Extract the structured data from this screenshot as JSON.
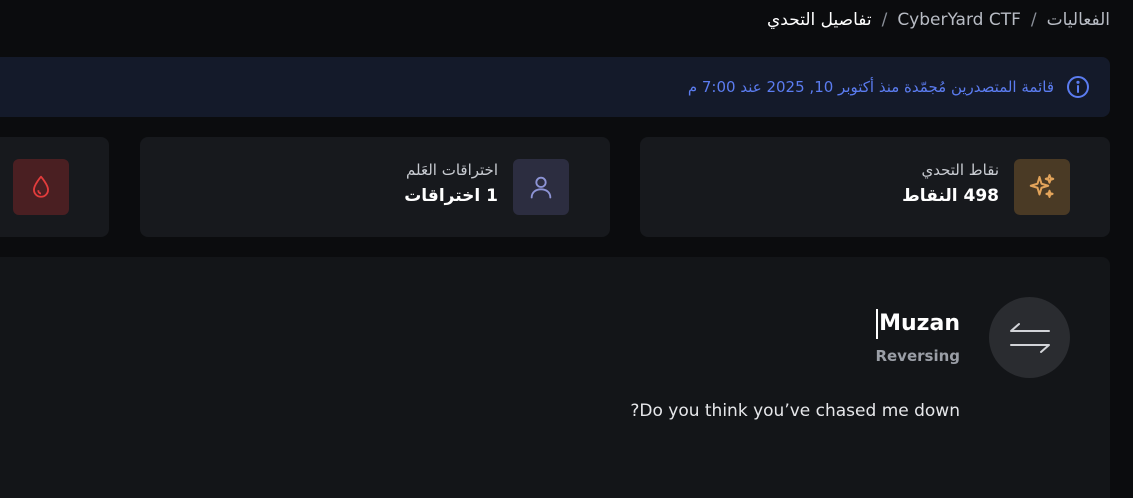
{
  "breadcrumb": {
    "items": [
      "الفعاليات",
      "CyberYard CTF",
      "تفاصيل التحدي"
    ],
    "separator": "/"
  },
  "notice": {
    "text": "قائمة المتصدرين مُجمّدة منذ أكتوبر 10, 2025 عند 7:00 م",
    "icon": "info-icon",
    "color": "#5b7cf0"
  },
  "stats": [
    {
      "label": "نقاط التحدي",
      "value": "498 النقاط",
      "icon": "sparkles-icon",
      "accent": "#e2a35a"
    },
    {
      "label": "اختراقات العَلم",
      "value": "1 اختراقات",
      "icon": "user-icon",
      "accent": "#8e94d6"
    },
    {
      "label": "",
      "value": "",
      "icon": "blood-drop-icon",
      "accent": "#e23c3c"
    }
  ],
  "challenge": {
    "name": "Muzan",
    "category": "Reversing",
    "description": "Do you think you’ve chased me down?",
    "avatar_icon": "arrows-exchange-icon"
  }
}
